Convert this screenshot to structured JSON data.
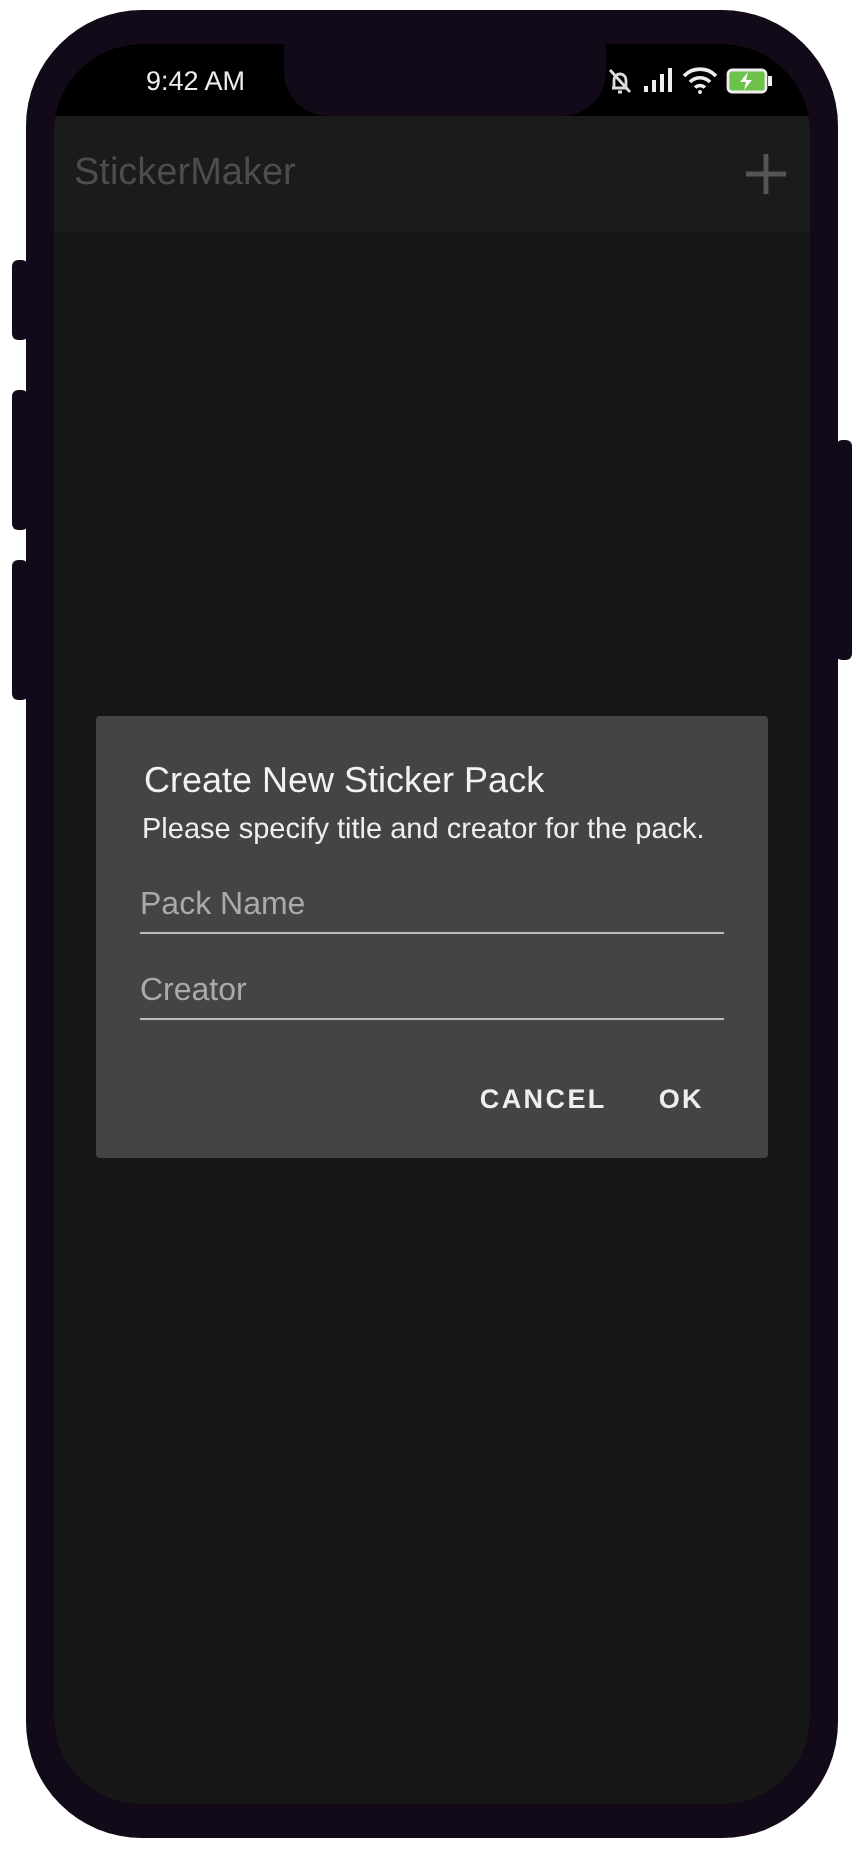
{
  "status_bar": {
    "time": "9:42 AM"
  },
  "app_bar": {
    "title": "StickerMaker"
  },
  "dialog": {
    "title": "Create New Sticker Pack",
    "message": "Please specify title and creator for the pack.",
    "fields": [
      {
        "placeholder": "Pack Name"
      },
      {
        "placeholder": "Creator"
      }
    ],
    "buttons": [
      "CANCEL",
      "OK"
    ]
  }
}
